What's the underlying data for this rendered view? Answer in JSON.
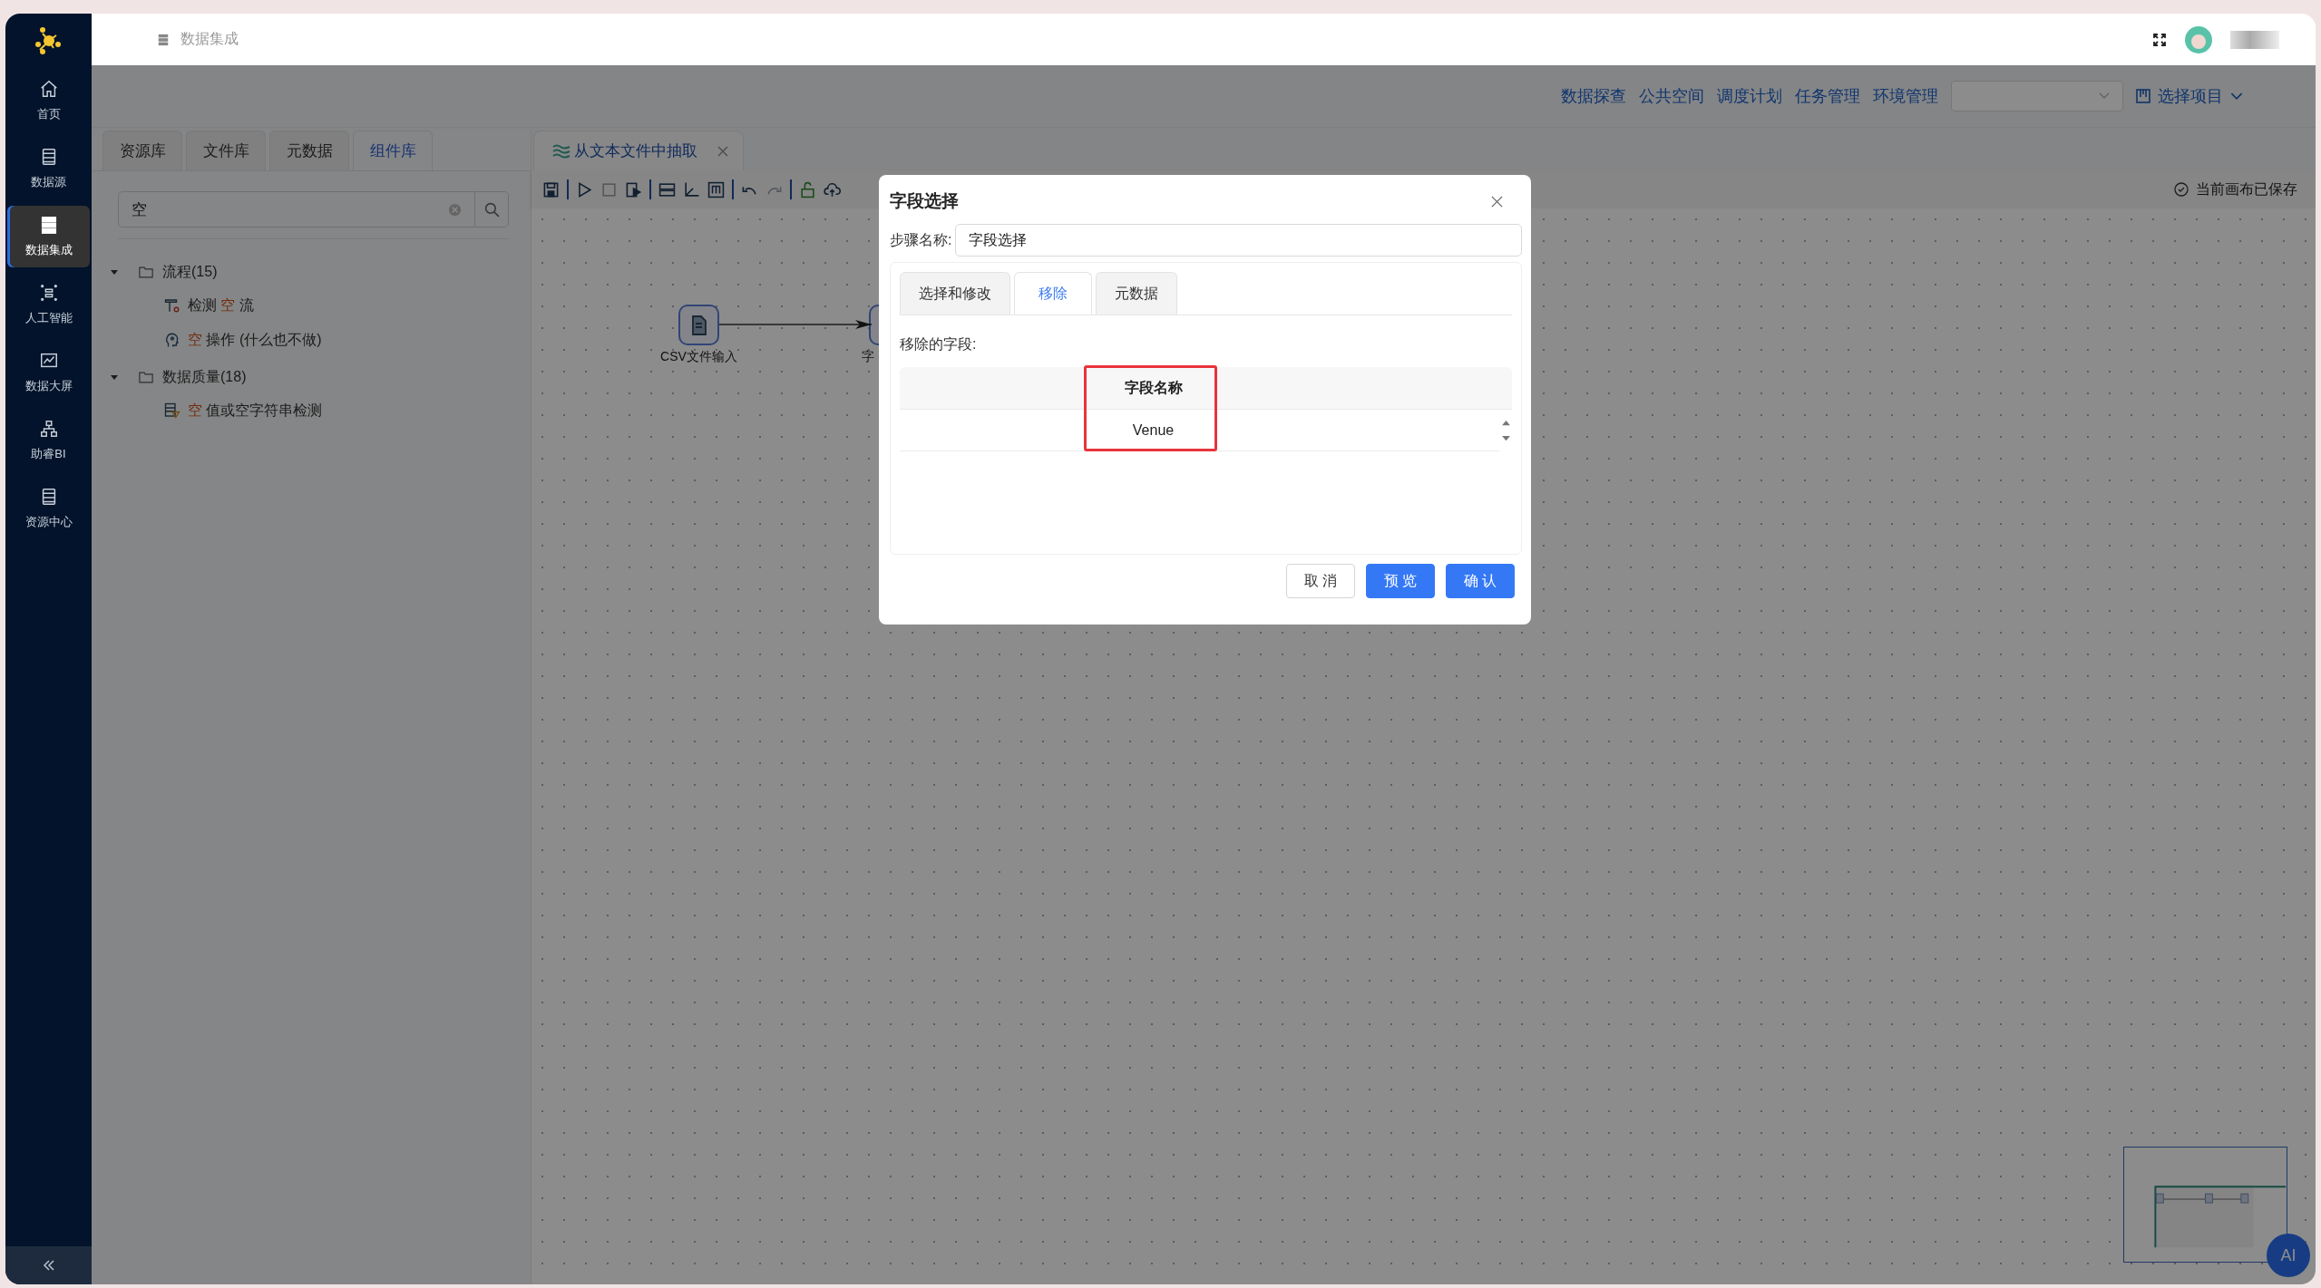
{
  "sidebar": {
    "items": [
      {
        "kind": "home",
        "label": "首页",
        "selected": false
      },
      {
        "kind": "datasource",
        "label": "数据源",
        "selected": false
      },
      {
        "kind": "integration",
        "label": "数据集成",
        "selected": true
      },
      {
        "kind": "ai",
        "label": "人工智能",
        "selected": false
      },
      {
        "kind": "screen",
        "label": "数据大屏",
        "selected": false
      },
      {
        "kind": "bi",
        "label": "助睿BI",
        "selected": false
      },
      {
        "kind": "resource",
        "label": "资源中心",
        "selected": false
      }
    ]
  },
  "header": {
    "title": "数据集成"
  },
  "nav_links": [
    "数据探查",
    "公共空间",
    "调度计划",
    "任务管理",
    "环境管理"
  ],
  "project_select": {
    "label": "选择项目"
  },
  "library_tabs": [
    {
      "label": "资源库",
      "selected": false
    },
    {
      "label": "文件库",
      "selected": false
    },
    {
      "label": "元数据",
      "selected": false
    },
    {
      "label": "组件库",
      "selected": true
    }
  ],
  "search": {
    "value": "空"
  },
  "tree": [
    {
      "label": "流程(15)",
      "expanded": true,
      "children": [
        {
          "kind": "hammer",
          "parts": [
            {
              "text": "检测 ",
              "match": false
            },
            {
              "text": "空",
              "match": true
            },
            {
              "text": " 流",
              "match": false
            }
          ]
        },
        {
          "kind": "head",
          "parts": [
            {
              "text": "空",
              "match": true
            },
            {
              "text": " 操作 (什么也不做)",
              "match": false
            }
          ]
        }
      ]
    },
    {
      "label": "数据质量(18)",
      "expanded": true,
      "children": [
        {
          "kind": "filter",
          "parts": [
            {
              "text": "空",
              "match": true
            },
            {
              "text": " 值或空字符串检测",
              "match": false
            }
          ]
        }
      ]
    }
  ],
  "editor_tab": {
    "title": "从文本文件中抽取"
  },
  "toolbar": [
    [
      {
        "kind": "save",
        "disabled": false
      }
    ],
    [
      {
        "kind": "run",
        "disabled": false
      },
      {
        "kind": "stop",
        "disabled": true
      },
      {
        "kind": "debug",
        "disabled": false
      }
    ],
    [
      {
        "kind": "layout",
        "disabled": false
      },
      {
        "kind": "axis",
        "disabled": false
      },
      {
        "kind": "frame",
        "disabled": false
      }
    ],
    [
      {
        "kind": "undo",
        "disabled": false
      },
      {
        "kind": "redo",
        "disabled": true
      }
    ],
    [
      {
        "kind": "lock",
        "disabled": false
      },
      {
        "kind": "upload",
        "disabled": false
      }
    ]
  ],
  "save_status": "当前画布已保存",
  "canvas": {
    "nodes": [
      {
        "kind": "csv",
        "label": "CSV文件输入"
      },
      {
        "kind": "field",
        "label": "字"
      }
    ]
  },
  "dialog": {
    "title": "字段选择",
    "step_name_label": "步骤名称:",
    "step_name": "字段选择",
    "tabs": [
      {
        "label": "选择和修改",
        "selected": false
      },
      {
        "label": "移除",
        "selected": true
      },
      {
        "label": "元数据",
        "selected": false
      }
    ],
    "section_label": "移除的字段:",
    "columns": [
      {
        "label": "字段名称",
        "highlighted": true
      }
    ],
    "rows": [
      [
        "Venue"
      ]
    ],
    "buttons": [
      {
        "label": "取 消",
        "kind": "default"
      },
      {
        "label": "预 览",
        "kind": "primary"
      },
      {
        "label": "确 认",
        "kind": "primary"
      }
    ]
  },
  "ai_button": {
    "label": "AI"
  }
}
